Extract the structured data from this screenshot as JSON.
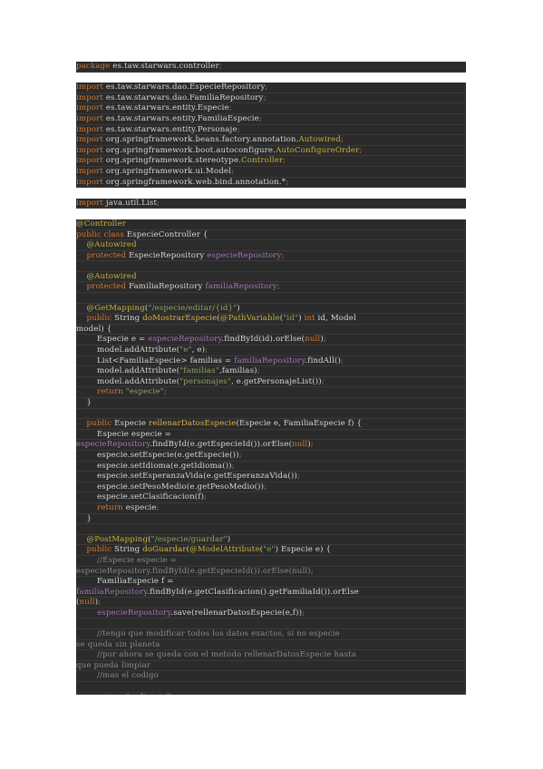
{
  "document": {
    "lines": [
      {
        "gap": false,
        "tokens": [
          {
            "t": "package",
            "k": "keyword"
          },
          {
            "t": " es.taw.starwars.controller",
            "k": "plain"
          },
          {
            "t": ";",
            "k": "keyword"
          }
        ]
      },
      {
        "gap": true,
        "tokens": []
      },
      {
        "gap": false,
        "tokens": [
          {
            "t": "import",
            "k": "keyword"
          },
          {
            "t": " es.taw.starwars.dao.EspecieRepository",
            "k": "plain"
          },
          {
            "t": ";",
            "k": "keyword"
          }
        ]
      },
      {
        "gap": false,
        "tokens": [
          {
            "t": "import",
            "k": "keyword"
          },
          {
            "t": " es.taw.starwars.dao.FamiliaRepository",
            "k": "plain"
          },
          {
            "t": ";",
            "k": "keyword"
          }
        ]
      },
      {
        "gap": false,
        "tokens": [
          {
            "t": "import",
            "k": "keyword"
          },
          {
            "t": " es.taw.starwars.entity.Especie",
            "k": "plain"
          },
          {
            "t": ";",
            "k": "keyword"
          }
        ]
      },
      {
        "gap": false,
        "tokens": [
          {
            "t": "import",
            "k": "keyword"
          },
          {
            "t": " es.taw.starwars.entity.FamiliaEspecie",
            "k": "plain"
          },
          {
            "t": ";",
            "k": "keyword"
          }
        ]
      },
      {
        "gap": false,
        "tokens": [
          {
            "t": "import",
            "k": "keyword"
          },
          {
            "t": " es.taw.starwars.entity.Personaje",
            "k": "plain"
          },
          {
            "t": ";",
            "k": "keyword"
          }
        ]
      },
      {
        "gap": false,
        "tokens": [
          {
            "t": "import",
            "k": "keyword"
          },
          {
            "t": " org.springframework.beans.factory.annotation.",
            "k": "plain"
          },
          {
            "t": "Autowired",
            "k": "annotation"
          },
          {
            "t": ";",
            "k": "keyword"
          }
        ]
      },
      {
        "gap": false,
        "tokens": [
          {
            "t": "import",
            "k": "keyword"
          },
          {
            "t": " org.springframework.boot.autoconfigure.",
            "k": "plain"
          },
          {
            "t": "AutoConfigureOrder",
            "k": "annotation"
          },
          {
            "t": ";",
            "k": "keyword"
          }
        ]
      },
      {
        "gap": false,
        "tokens": [
          {
            "t": "import",
            "k": "keyword"
          },
          {
            "t": " org.springframework.stereotype.",
            "k": "plain"
          },
          {
            "t": "Controller",
            "k": "annotation"
          },
          {
            "t": ";",
            "k": "keyword"
          }
        ]
      },
      {
        "gap": false,
        "tokens": [
          {
            "t": "import",
            "k": "keyword"
          },
          {
            "t": " org.springframework.ui.Model",
            "k": "plain"
          },
          {
            "t": ";",
            "k": "keyword"
          }
        ]
      },
      {
        "gap": false,
        "tokens": [
          {
            "t": "import",
            "k": "keyword"
          },
          {
            "t": " org.springframework.web.bind.annotation.*",
            "k": "plain"
          },
          {
            "t": ";",
            "k": "keyword"
          }
        ]
      },
      {
        "gap": true,
        "tokens": []
      },
      {
        "gap": false,
        "tokens": [
          {
            "t": "import",
            "k": "keyword"
          },
          {
            "t": " java.util.List",
            "k": "plain"
          },
          {
            "t": ";",
            "k": "keyword"
          }
        ]
      },
      {
        "gap": true,
        "tokens": []
      },
      {
        "gap": false,
        "tokens": [
          {
            "t": "@Controller",
            "k": "annotation"
          }
        ]
      },
      {
        "gap": false,
        "tokens": [
          {
            "t": "public class",
            "k": "keyword"
          },
          {
            "t": " EspecieController {",
            "k": "plain"
          }
        ]
      },
      {
        "gap": false,
        "tokens": [
          {
            "t": "    ",
            "k": "plain"
          },
          {
            "t": "@Autowired",
            "k": "annotation"
          }
        ]
      },
      {
        "gap": false,
        "tokens": [
          {
            "t": "    ",
            "k": "plain"
          },
          {
            "t": "protected",
            "k": "keyword"
          },
          {
            "t": " EspecieRepository ",
            "k": "plain"
          },
          {
            "t": "especieRepository",
            "k": "field"
          },
          {
            "t": ";",
            "k": "keyword"
          }
        ]
      },
      {
        "gap": false,
        "tokens": []
      },
      {
        "gap": false,
        "tokens": [
          {
            "t": "    ",
            "k": "plain"
          },
          {
            "t": "@Autowired",
            "k": "annotation"
          }
        ]
      },
      {
        "gap": false,
        "tokens": [
          {
            "t": "    ",
            "k": "plain"
          },
          {
            "t": "protected",
            "k": "keyword"
          },
          {
            "t": " FamiliaRepository ",
            "k": "plain"
          },
          {
            "t": "familiaRepository",
            "k": "field"
          },
          {
            "t": ";",
            "k": "keyword"
          }
        ]
      },
      {
        "gap": false,
        "tokens": []
      },
      {
        "gap": false,
        "tokens": [
          {
            "t": "    ",
            "k": "plain"
          },
          {
            "t": "@GetMapping",
            "k": "annotation"
          },
          {
            "t": "(",
            "k": "plain"
          },
          {
            "t": "\"/especie/editar/{id}\"",
            "k": "string"
          },
          {
            "t": ")",
            "k": "plain"
          }
        ]
      },
      {
        "gap": false,
        "tokens": [
          {
            "t": "    ",
            "k": "plain"
          },
          {
            "t": "public",
            "k": "keyword"
          },
          {
            "t": " String ",
            "k": "plain"
          },
          {
            "t": "doMostrarEspecie",
            "k": "method"
          },
          {
            "t": "(",
            "k": "plain"
          },
          {
            "t": "@PathVariable",
            "k": "annotation"
          },
          {
            "t": "(",
            "k": "plain"
          },
          {
            "t": "\"id\"",
            "k": "string"
          },
          {
            "t": ") ",
            "k": "plain"
          },
          {
            "t": "int",
            "k": "keyword"
          },
          {
            "t": " id, Model",
            "k": "plain"
          }
        ]
      },
      {
        "gap": false,
        "tokens": [
          {
            "t": "model) {",
            "k": "plain"
          }
        ]
      },
      {
        "gap": false,
        "tokens": [
          {
            "t": "        Especie e = ",
            "k": "plain"
          },
          {
            "t": "especieRepository",
            "k": "field"
          },
          {
            "t": ".findById(id).orElse(",
            "k": "plain"
          },
          {
            "t": "null",
            "k": "keyword"
          },
          {
            "t": ")",
            "k": "plain"
          },
          {
            "t": ";",
            "k": "keyword"
          }
        ]
      },
      {
        "gap": false,
        "tokens": [
          {
            "t": "        model.addAttribute(",
            "k": "plain"
          },
          {
            "t": "\"e\"",
            "k": "string"
          },
          {
            "t": ", e)",
            "k": "plain"
          },
          {
            "t": ";",
            "k": "keyword"
          }
        ]
      },
      {
        "gap": false,
        "tokens": [
          {
            "t": "        List<FamiliaEspecie> familias = ",
            "k": "plain"
          },
          {
            "t": "familiaRepository",
            "k": "field"
          },
          {
            "t": ".findAll()",
            "k": "plain"
          },
          {
            "t": ";",
            "k": "keyword"
          }
        ]
      },
      {
        "gap": false,
        "tokens": [
          {
            "t": "        model.addAttribute(",
            "k": "plain"
          },
          {
            "t": "\"familias\"",
            "k": "string"
          },
          {
            "t": ",familias)",
            "k": "plain"
          },
          {
            "t": ";",
            "k": "keyword"
          }
        ]
      },
      {
        "gap": false,
        "tokens": [
          {
            "t": "        model.addAttribute(",
            "k": "plain"
          },
          {
            "t": "\"personajes\"",
            "k": "string"
          },
          {
            "t": ", e.getPersonajeList())",
            "k": "plain"
          },
          {
            "t": ";",
            "k": "keyword"
          }
        ]
      },
      {
        "gap": false,
        "tokens": [
          {
            "t": "        ",
            "k": "plain"
          },
          {
            "t": "return",
            "k": "keyword"
          },
          {
            "t": " ",
            "k": "plain"
          },
          {
            "t": "\"especie\"",
            "k": "string"
          },
          {
            "t": ";",
            "k": "keyword"
          }
        ]
      },
      {
        "gap": false,
        "tokens": [
          {
            "t": "    }",
            "k": "plain"
          }
        ]
      },
      {
        "gap": false,
        "tokens": []
      },
      {
        "gap": false,
        "tokens": [
          {
            "t": "    ",
            "k": "plain"
          },
          {
            "t": "public",
            "k": "keyword"
          },
          {
            "t": " Especie ",
            "k": "plain"
          },
          {
            "t": "rellenarDatosEspecie",
            "k": "method"
          },
          {
            "t": "(Especie e, FamiliaEspecie f) {",
            "k": "plain"
          }
        ]
      },
      {
        "gap": false,
        "tokens": [
          {
            "t": "        Especie especie =",
            "k": "plain"
          }
        ]
      },
      {
        "gap": false,
        "tokens": [
          {
            "t": "especieRepository",
            "k": "field"
          },
          {
            "t": ".findById(e.getEspecieId()).orElse(",
            "k": "plain"
          },
          {
            "t": "null",
            "k": "keyword"
          },
          {
            "t": ")",
            "k": "plain"
          },
          {
            "t": ";",
            "k": "keyword"
          }
        ]
      },
      {
        "gap": false,
        "tokens": [
          {
            "t": "        especie.setEspecie(e.getEspecie())",
            "k": "plain"
          },
          {
            "t": ";",
            "k": "keyword"
          }
        ]
      },
      {
        "gap": false,
        "tokens": [
          {
            "t": "        especie.setIdioma(e.getIdioma())",
            "k": "plain"
          },
          {
            "t": ";",
            "k": "keyword"
          }
        ]
      },
      {
        "gap": false,
        "tokens": [
          {
            "t": "        especie.setEsperanzaVida(e.getEsperanzaVida())",
            "k": "plain"
          },
          {
            "t": ";",
            "k": "keyword"
          }
        ]
      },
      {
        "gap": false,
        "tokens": [
          {
            "t": "        especie.setPesoMedio(e.getPesoMedio())",
            "k": "plain"
          },
          {
            "t": ";",
            "k": "keyword"
          }
        ]
      },
      {
        "gap": false,
        "tokens": [
          {
            "t": "        especie.setClasificacion(f)",
            "k": "plain"
          },
          {
            "t": ";",
            "k": "keyword"
          }
        ]
      },
      {
        "gap": false,
        "tokens": [
          {
            "t": "        ",
            "k": "plain"
          },
          {
            "t": "return",
            "k": "keyword"
          },
          {
            "t": " especie",
            "k": "plain"
          },
          {
            "t": ";",
            "k": "keyword"
          }
        ]
      },
      {
        "gap": false,
        "tokens": [
          {
            "t": "    }",
            "k": "plain"
          }
        ]
      },
      {
        "gap": false,
        "tokens": []
      },
      {
        "gap": false,
        "tokens": [
          {
            "t": "    ",
            "k": "plain"
          },
          {
            "t": "@PostMapping",
            "k": "annotation"
          },
          {
            "t": "(",
            "k": "plain"
          },
          {
            "t": "\"/especie/guardar\"",
            "k": "string"
          },
          {
            "t": ")",
            "k": "plain"
          }
        ]
      },
      {
        "gap": false,
        "tokens": [
          {
            "t": "    ",
            "k": "plain"
          },
          {
            "t": "public",
            "k": "keyword"
          },
          {
            "t": " String ",
            "k": "plain"
          },
          {
            "t": "doGuardar",
            "k": "method"
          },
          {
            "t": "(",
            "k": "plain"
          },
          {
            "t": "@ModelAttribute",
            "k": "annotation"
          },
          {
            "t": "(",
            "k": "plain"
          },
          {
            "t": "\"e\"",
            "k": "string"
          },
          {
            "t": ") Especie e) {",
            "k": "plain"
          }
        ]
      },
      {
        "gap": false,
        "tokens": [
          {
            "t": "        //Especie especie =",
            "k": "comment"
          }
        ]
      },
      {
        "gap": false,
        "tokens": [
          {
            "t": "especieRepository.findById(e.getEspecieId()).orElse(null);",
            "k": "comment"
          }
        ]
      },
      {
        "gap": false,
        "tokens": [
          {
            "t": "        FamiliaEspecie f =",
            "k": "plain"
          }
        ]
      },
      {
        "gap": false,
        "tokens": [
          {
            "t": "familiaRepository",
            "k": "field"
          },
          {
            "t": ".findById(e.getClasificacion().getFamiliaId()).orElse",
            "k": "plain"
          }
        ]
      },
      {
        "gap": false,
        "tokens": [
          {
            "t": "(",
            "k": "plain"
          },
          {
            "t": "null",
            "k": "keyword"
          },
          {
            "t": ")",
            "k": "plain"
          },
          {
            "t": ";",
            "k": "keyword"
          }
        ]
      },
      {
        "gap": false,
        "tokens": [
          {
            "t": "        ",
            "k": "plain"
          },
          {
            "t": "especieRepository",
            "k": "field"
          },
          {
            "t": ".save(rellenarDatosEspecie(e,f))",
            "k": "plain"
          },
          {
            "t": ";",
            "k": "keyword"
          }
        ]
      },
      {
        "gap": false,
        "tokens": []
      },
      {
        "gap": false,
        "tokens": [
          {
            "t": "        //tengo que modificar todos los datos exactos, si no especie",
            "k": "comment"
          }
        ]
      },
      {
        "gap": false,
        "tokens": [
          {
            "t": "se queda sin planeta",
            "k": "comment"
          }
        ]
      },
      {
        "gap": false,
        "tokens": [
          {
            "t": "        //por ahora se queda con el metodo rellenarDatosEspecie hasta",
            "k": "comment"
          }
        ]
      },
      {
        "gap": false,
        "tokens": [
          {
            "t": "que pueda limpiar",
            "k": "comment"
          }
        ]
      },
      {
        "gap": false,
        "tokens": [
          {
            "t": "        //mas el codigo",
            "k": "comment"
          }
        ]
      },
      {
        "gap": false,
        "tokens": []
      },
      {
        "gap": false,
        "tokens": [
          {
            "t": "        ",
            "k": "plain"
          },
          {
            "t": "return",
            "k": "keyword"
          },
          {
            "t": " ",
            "k": "plain"
          },
          {
            "t": "\"redirect:/\"",
            "k": "string"
          },
          {
            "t": ";",
            "k": "keyword"
          }
        ]
      }
    ]
  },
  "colors": {
    "background": "#2b2b2b",
    "keyword": "#d7782b",
    "annotation": "#c9b23a",
    "field": "#a775b8",
    "string": "#8fa65a",
    "method": "#e2b64a",
    "comment": "#8a8a8a",
    "plain": "#d8d8d8"
  }
}
